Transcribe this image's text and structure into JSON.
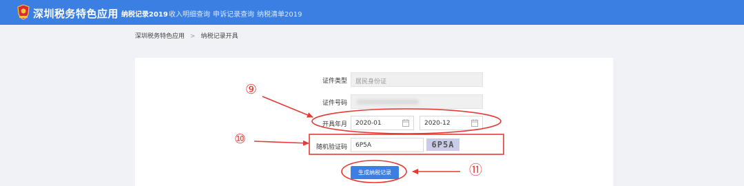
{
  "app": {
    "title": "深圳税务特色应用"
  },
  "nav": [
    {
      "label": "纳税记录2019",
      "active": true
    },
    {
      "label": "收入明细查询",
      "active": false
    },
    {
      "label": "申诉记录查询",
      "active": false
    },
    {
      "label": "纳税清单2019",
      "active": false
    }
  ],
  "breadcrumb": {
    "root": "深圳税务特色应用",
    "separator": ">",
    "current": "纳税记录开具"
  },
  "form": {
    "id_type_label": "证件类型",
    "id_type_value": "居民身份证",
    "id_number_label": "证件号码",
    "id_number_value": "",
    "period_label": "开具年月",
    "start_month": "2020-01",
    "end_month": "2020-12",
    "captcha_label": "随机验证码",
    "captcha_input": "6P5A",
    "captcha_image_text": "6P5A",
    "submit_label": "生成纳税记录"
  },
  "annotations": {
    "mark_9": "⑨",
    "mark_10": "⑩",
    "mark_11": "⑪",
    "color": "#e53935"
  },
  "colors": {
    "primary": "#3b7fe3",
    "page_bg": "#f0f2f5",
    "panel_bg": "#ffffff"
  }
}
